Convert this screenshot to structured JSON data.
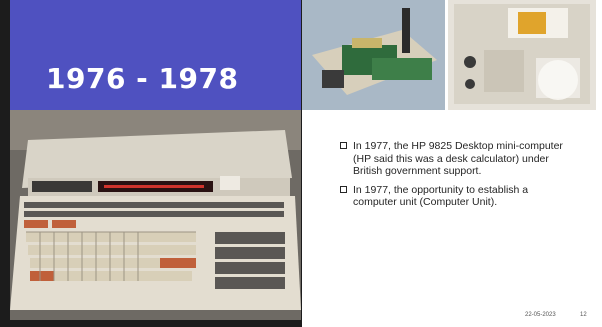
{
  "slide": {
    "title": "1976 - 1978",
    "bullets": [
      "In 1977, the HP 9825 Desktop mini-computer (HP said this was a desk calculator) under British government support.",
      "In 1977, the opportunity to establish a computer unit (Computer Unit)."
    ],
    "footer": {
      "date": "22-05-2023",
      "page": "12"
    }
  },
  "colors": {
    "title_bg": "#4f51c0",
    "frame": "#1c1c1c",
    "text": "#262626"
  },
  "icons": {
    "bullet": "checkbox-square-icon"
  }
}
